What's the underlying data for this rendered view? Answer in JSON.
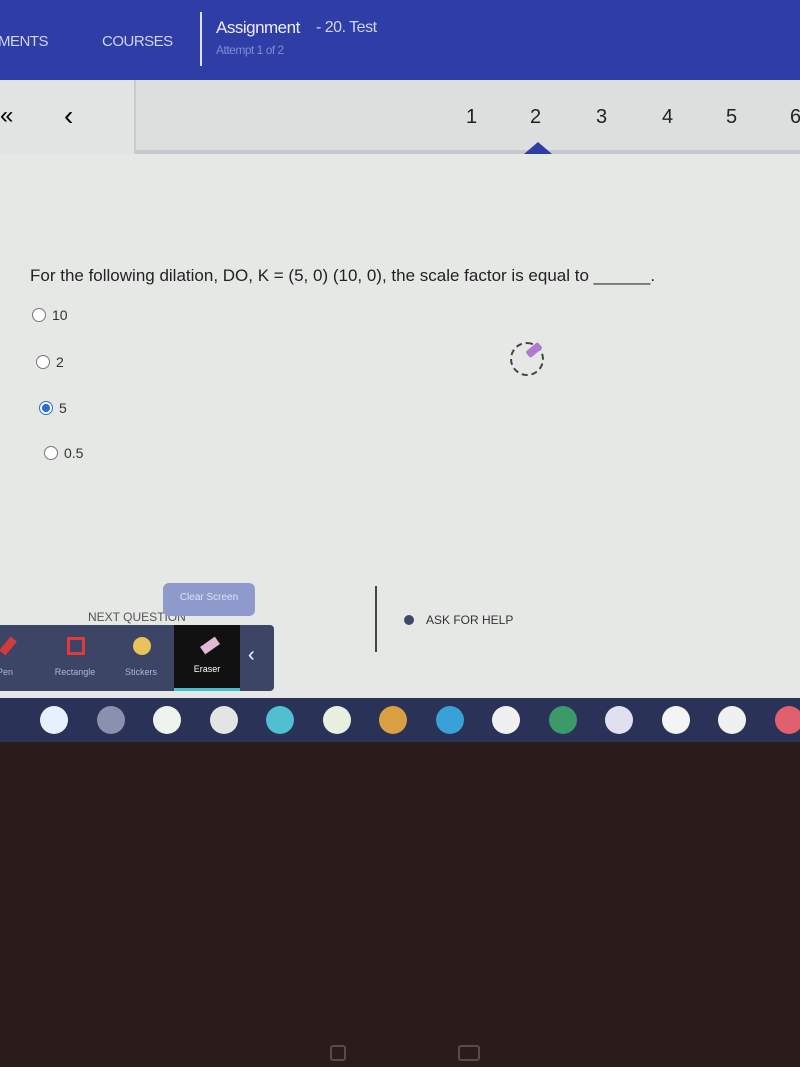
{
  "header": {
    "nav_assignments": "MENTS",
    "nav_courses": "COURSES",
    "title": "Assignment",
    "test": "- 20. Test",
    "attempt": "Attempt 1 of 2"
  },
  "pager": {
    "first": "«",
    "prev": "‹",
    "pages": [
      "1",
      "2",
      "3",
      "4",
      "5",
      "6"
    ],
    "current": "2"
  },
  "question": {
    "text": "For the following dilation, DO, K = (5, 0) (10, 0), the scale factor is equal to ______.",
    "options": [
      "10",
      "2",
      "5",
      "0.5"
    ],
    "selected": "5"
  },
  "footer": {
    "next": "NEXT QUESTION",
    "clear": "Clear Screen",
    "help": "ASK FOR HELP"
  },
  "tools": [
    {
      "label": "Pen",
      "icon": "pen-icon"
    },
    {
      "label": "Rectangle",
      "icon": "rectangle-icon"
    },
    {
      "label": "Stickers",
      "icon": "sticker-icon"
    },
    {
      "label": "Eraser",
      "icon": "eraser-icon"
    }
  ],
  "taskbar": [
    "outlook",
    "settings",
    "play-store",
    "stop-app",
    "classkick",
    "classroom",
    "chrome",
    "zoom",
    "drive",
    "app-10",
    "app-11",
    "app-12",
    "app-13",
    "app-14"
  ]
}
